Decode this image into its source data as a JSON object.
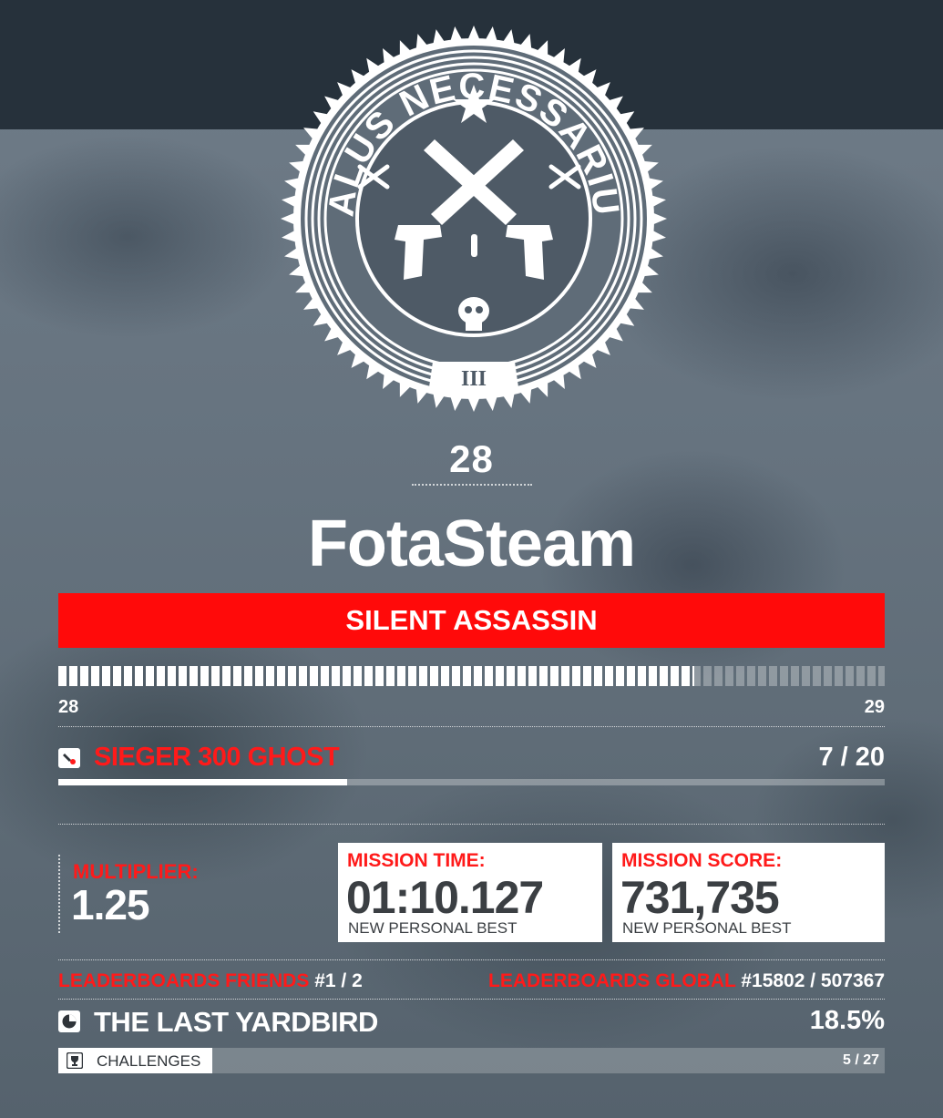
{
  "emblem": {
    "title": "MALUS NECESSARIUM",
    "numeral": "III"
  },
  "profile": {
    "level": "28",
    "name": "FotaSteam"
  },
  "rating": "SILENT ASSASSIN",
  "xp": {
    "from_level": "28",
    "to_level": "29",
    "progress": 0.77
  },
  "unlock": {
    "icon": "unlock-icon",
    "name": "SIEGER 300 GHOST",
    "count": "7 / 20",
    "progress": 0.35
  },
  "multiplier": {
    "label": "MULTIPLIER:",
    "value": "1.25"
  },
  "mission_time": {
    "label": "MISSION TIME:",
    "value": "01:10.127",
    "note": "NEW PERSONAL BEST"
  },
  "mission_score": {
    "label": "MISSION SCORE:",
    "value": "731,735",
    "note": "NEW PERSONAL BEST"
  },
  "leaderboards": {
    "friends_label": "LEADERBOARDS FRIENDS",
    "friends_value": "#1 / 2",
    "global_label": "LEADERBOARDS GLOBAL",
    "global_value": "#15802 / 507367"
  },
  "mission": {
    "icon": "pie-chart-icon",
    "name": "THE LAST YARDBIRD",
    "completion": "18.5%"
  },
  "challenges": {
    "icon": "trophy-icon",
    "label": "CHALLENGES",
    "count": "5 / 27"
  },
  "colors": {
    "accent_red": "#ff0a0a",
    "top_bar": "#26313b"
  }
}
